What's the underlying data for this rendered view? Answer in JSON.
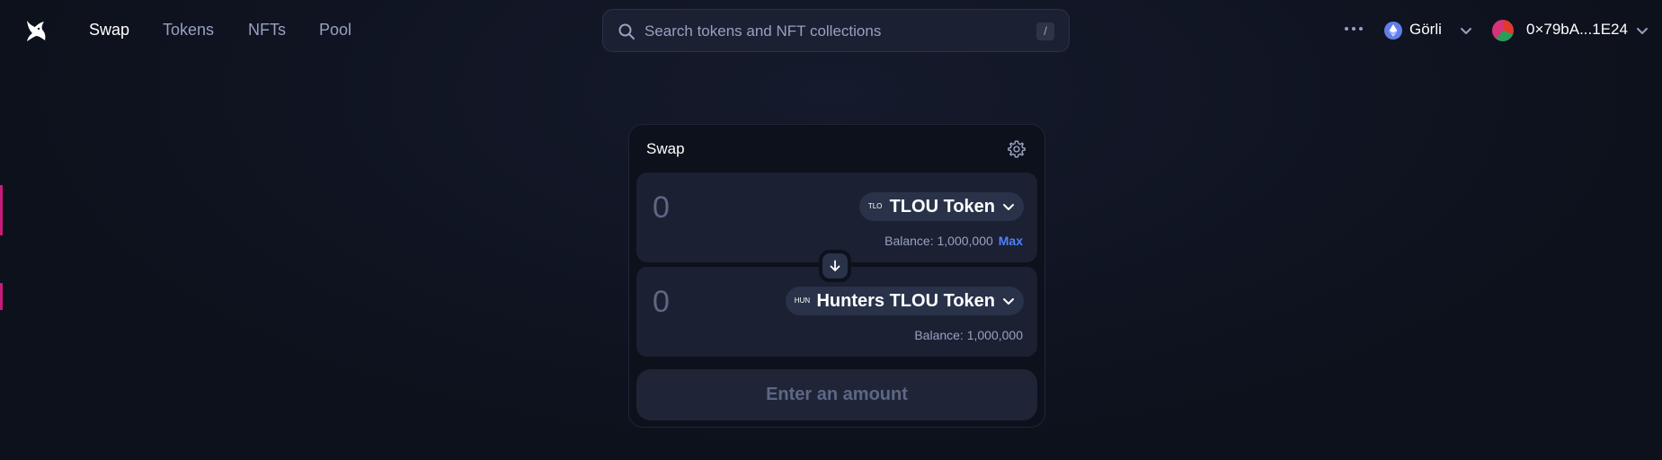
{
  "nav": {
    "logo": "uniswap-unicorn-logo",
    "links": [
      {
        "label": "Swap",
        "active": true
      },
      {
        "label": "Tokens",
        "active": false
      },
      {
        "label": "NFTs",
        "active": false
      },
      {
        "label": "Pool",
        "active": false
      }
    ],
    "search": {
      "placeholder": "Search tokens and NFT collections",
      "value": "",
      "shortcut": "/"
    },
    "more_icon": "more-dots-icon",
    "network": {
      "label": "Görli",
      "icon": "ethereum-icon"
    },
    "account": {
      "label": "0×79bA...1E24"
    }
  },
  "swap": {
    "title": "Swap",
    "settings_icon": "gear-icon",
    "input": {
      "amount_placeholder": "0",
      "token_logo_text": "TLO",
      "token_name": "TLOU Token",
      "balance": "Balance: 1,000,000",
      "max_label": "Max"
    },
    "switch_icon": "arrow-down-icon",
    "output": {
      "amount_placeholder": "0",
      "token_logo_text": "HUN",
      "token_name": "Hunters TLOU Token",
      "balance": "Balance: 1,000,000"
    },
    "action_button": "Enter an amount"
  },
  "colors": {
    "background": "#0d111c",
    "panel": "#1b2133",
    "accent": "#4c82fb",
    "muted_text": "#98a1c0"
  }
}
